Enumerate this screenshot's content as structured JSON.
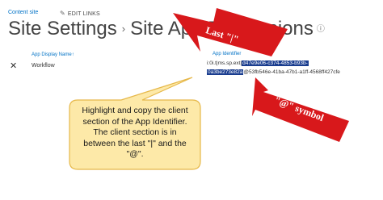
{
  "nav": {
    "content_site": "Content site",
    "edit_links": "EDIT LINKS",
    "edit_links_icon": "pencil-icon"
  },
  "title": {
    "site_settings": "Site Settings",
    "separator": "›",
    "page": "Site App Permissions",
    "info_icon": "ⓘ"
  },
  "table": {
    "col_display_name": "App Display Name↑",
    "col_identifier": "App Identifier",
    "row": {
      "remove_icon": "✕",
      "display_name": "Workflow",
      "identifier_prefix": "i:0i.t|ms.sp.ext|",
      "identifier_client_part1": "d47e9e06-c374-4853-b93b-",
      "identifier_client_part2": "0a3be273e82a",
      "identifier_suffix": "@53fb546e-41ba-47b1-a1ff-4568ff427cfe"
    }
  },
  "annotations": {
    "arrow_top_label": "Last \"|\"",
    "arrow_bottom_label": "\"@\" symbol",
    "callout": "Highlight and copy the client section of the App Identifier. The client section is in between the last \"|\" and the \"@\"."
  },
  "colors": {
    "arrow_red": "#d8181b",
    "callout_fill": "#fde9a8",
    "callout_border": "#e6b84a",
    "highlight": "#1a3d8f",
    "link_blue": "#0072c6"
  }
}
